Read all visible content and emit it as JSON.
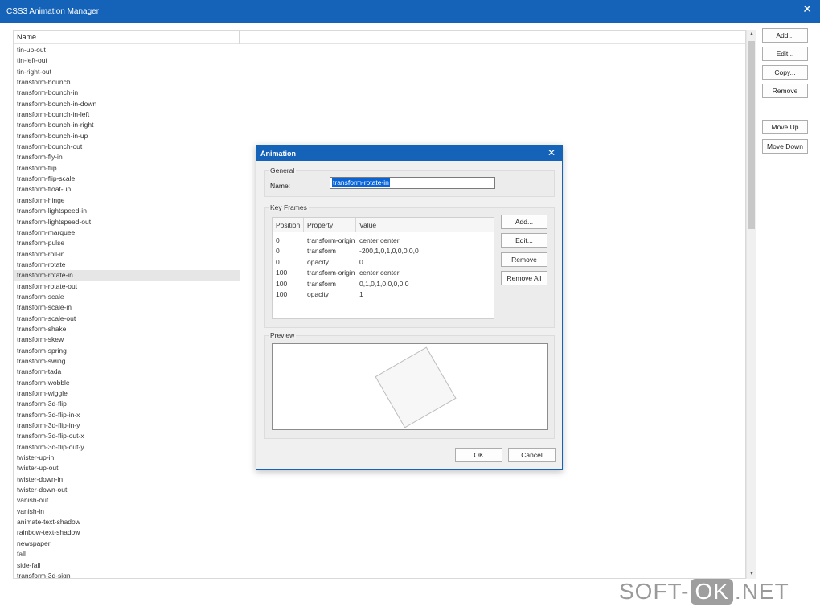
{
  "window": {
    "title": "CSS3 Animation Manager"
  },
  "list": {
    "header_name": "Name",
    "items": [
      "tin-up-out",
      "tin-left-out",
      "tin-right-out",
      "transform-bounch",
      "transform-bounch-in",
      "transform-bounch-in-down",
      "transform-bounch-in-left",
      "transform-bounch-in-right",
      "transform-bounch-in-up",
      "transform-bounch-out",
      "transform-fly-in",
      "transform-flip",
      "transform-flip-scale",
      "transform-float-up",
      "transform-hinge",
      "transform-lightspeed-in",
      "transform-lightspeed-out",
      "transform-marquee",
      "transform-pulse",
      "transform-roll-in",
      "transform-rotate",
      "transform-rotate-in",
      "transform-rotate-out",
      "transform-scale",
      "transform-scale-in",
      "transform-scale-out",
      "transform-shake",
      "transform-skew",
      "transform-spring",
      "transform-swing",
      "transform-tada",
      "transform-wobble",
      "transform-wiggle",
      "transform-3d-flip",
      "transform-3d-flip-in-x",
      "transform-3d-flip-in-y",
      "transform-3d-flip-out-x",
      "transform-3d-flip-out-y",
      "twister-up-in",
      "twister-up-out",
      "twister-down-in",
      "twister-down-out",
      "vanish-out",
      "vanish-in",
      "animate-text-shadow",
      "rainbow-text-shadow",
      "newspaper",
      "fall",
      "side-fall",
      "transform-3d-sign"
    ],
    "selected": "transform-rotate-in"
  },
  "sidebar_buttons": {
    "add": "Add...",
    "edit": "Edit...",
    "copy": "Copy...",
    "remove": "Remove",
    "move_up": "Move Up",
    "move_down": "Move Down"
  },
  "dialog": {
    "title": "Animation",
    "general_label": "General",
    "name_label": "Name:",
    "name_value": "transform-rotate-in",
    "keyframes_label": "Key Frames",
    "columns": [
      "Position",
      "Property",
      "Value"
    ],
    "rows": [
      [
        "0",
        "transform-origin",
        "center center"
      ],
      [
        "0",
        "transform",
        "-200,1,0,1,0,0,0,0,0"
      ],
      [
        "0",
        "opacity",
        "0"
      ],
      [
        "100",
        "transform-origin",
        "center center"
      ],
      [
        "100",
        "transform",
        "0,1,0,1,0,0,0,0,0"
      ],
      [
        "100",
        "opacity",
        "1"
      ]
    ],
    "kf_buttons": {
      "add": "Add...",
      "edit": "Edit...",
      "remove": "Remove",
      "remove_all": "Remove All"
    },
    "preview_label": "Preview",
    "ok": "OK",
    "cancel": "Cancel"
  },
  "watermark": {
    "left": "SOFT-",
    "mid": "OK",
    "right": ".NET"
  }
}
